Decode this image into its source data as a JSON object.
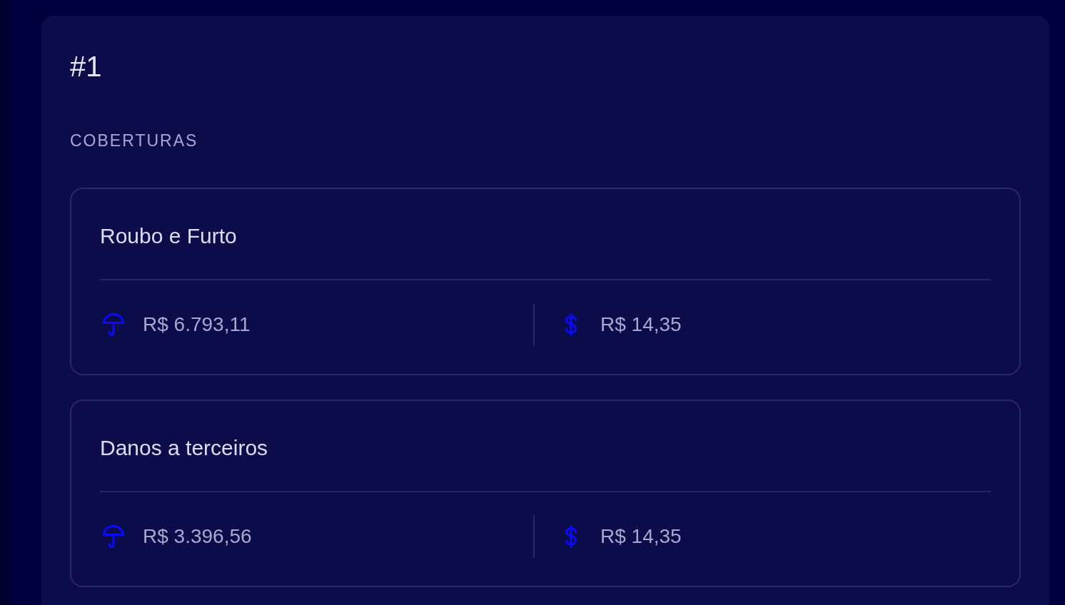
{
  "panel": {
    "title": "#1",
    "section_label": "COBERTURAS",
    "coverages": [
      {
        "name": "Roubo e Furto",
        "coverage_amount": "R$ 6.793,11",
        "price": "R$ 14,35"
      },
      {
        "name": "Danos a terceiros",
        "coverage_amount": "R$ 3.396,56",
        "price": "R$ 14,35"
      }
    ]
  }
}
